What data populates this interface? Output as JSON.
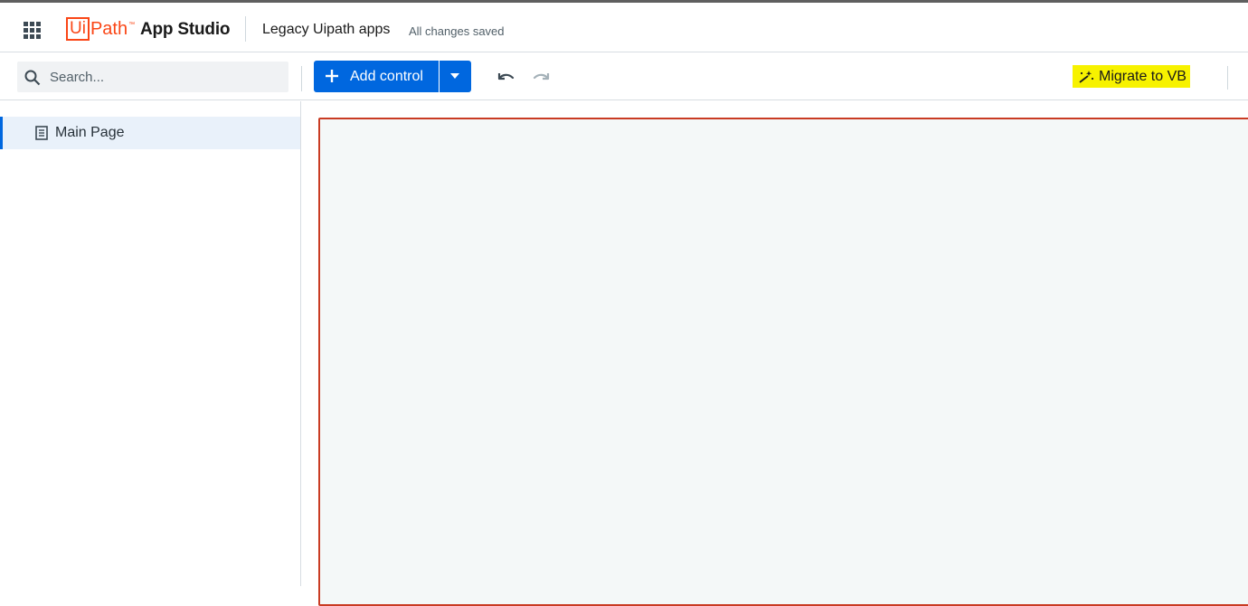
{
  "header": {
    "logo_box": "Ui",
    "logo_path": "Path",
    "logo_tm": "™",
    "app_name": "App Studio",
    "project_name": "Legacy Uipath apps",
    "save_status": "All changes saved"
  },
  "toolbar": {
    "search_placeholder": "Search...",
    "add_control_label": "Add control",
    "migrate_label": "Migrate to VB"
  },
  "sidebar": {
    "items": [
      {
        "label": "Main Page",
        "selected": true
      }
    ]
  },
  "colors": {
    "brand_orange": "#fa4616",
    "primary_blue": "#0067df",
    "highlight_yellow": "#f7f200",
    "canvas_border": "#c93b23",
    "canvas_bg": "#f4f8f8"
  },
  "icons": {
    "apps": "apps-grid-icon",
    "search": "search-icon",
    "add": "plus-icon",
    "dropdown": "chevron-down-icon",
    "undo": "undo-icon",
    "redo": "redo-icon",
    "migrate": "magic-wand-icon",
    "page": "page-icon"
  }
}
